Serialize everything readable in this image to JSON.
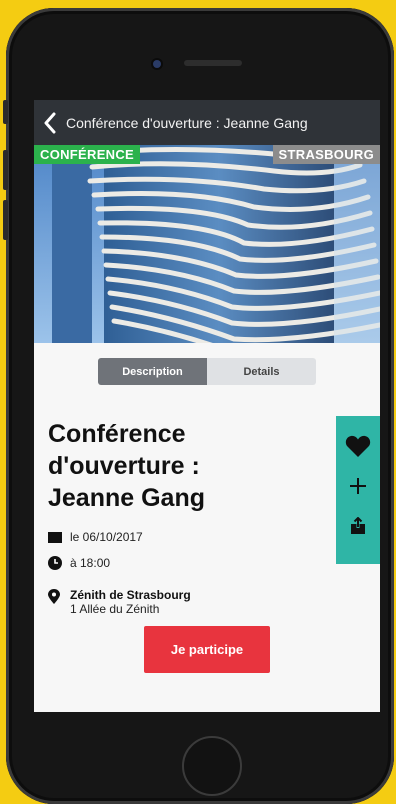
{
  "header": {
    "title": "Conférence d'ouverture : Jeanne Gang",
    "back_icon": "chevron-left-icon"
  },
  "hero": {
    "category_tag": "CONFÉRENCE",
    "city_tag": "STRASBOURG",
    "category_color": "#2bb24c"
  },
  "tabs": [
    {
      "label": "Description",
      "active": true
    },
    {
      "label": "Details",
      "active": false
    }
  ],
  "event": {
    "title_line1": "Conférence",
    "title_line2": "d'ouverture :",
    "title_line3": "Jeanne Gang",
    "date": "le 06/10/2017",
    "time": "à 18:00",
    "venue_name": "Zénith de Strasbourg",
    "venue_address": "1 Allée du Zénith"
  },
  "actions": {
    "favorite_icon": "heart-icon",
    "add_icon": "plus-icon",
    "share_icon": "share-icon",
    "rail_color": "#2fb5a6"
  },
  "cta": {
    "label": "Je participe",
    "color": "#e8343e"
  }
}
